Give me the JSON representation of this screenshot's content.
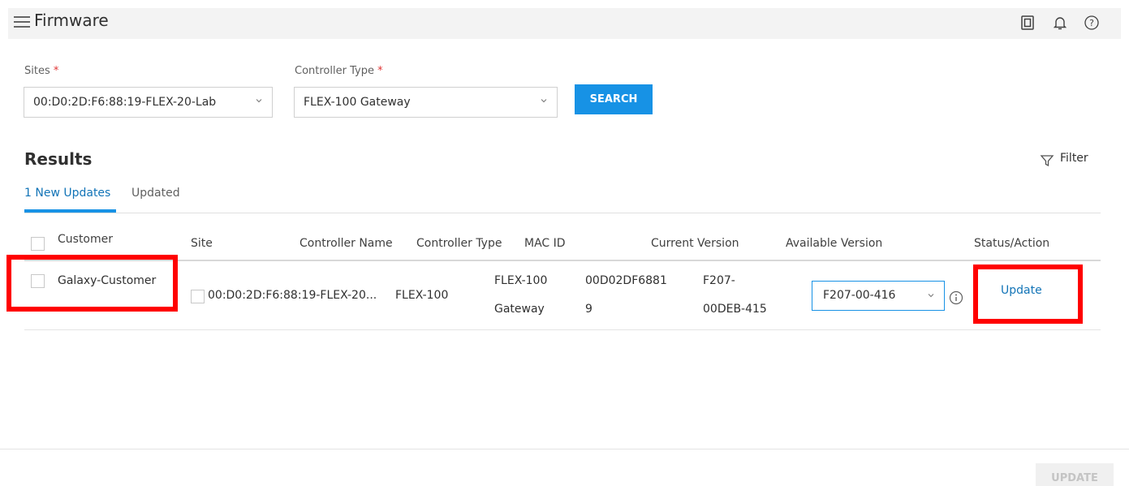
{
  "header": {
    "title": "Firmware",
    "icons": [
      "menu-icon",
      "tablet-icon",
      "bell-icon",
      "help-icon"
    ]
  },
  "form": {
    "sites": {
      "label": "Sites",
      "required_mark": "*",
      "value": "00:D0:2D:F6:88:19-FLEX-20-Lab"
    },
    "controller_type": {
      "label": "Controller Type",
      "required_mark": "*",
      "value": "FLEX-100 Gateway"
    },
    "search_label": "SEARCH"
  },
  "results": {
    "title": "Results",
    "filter_label": "Filter",
    "tabs": [
      {
        "label": "1 New Updates",
        "active": true
      },
      {
        "label": "Updated",
        "active": false
      }
    ]
  },
  "table": {
    "columns": [
      "Customer",
      "Site",
      "Controller Name",
      "Controller Type",
      "MAC ID",
      "Current Version",
      "Available Version",
      "Status/Action"
    ],
    "rows": [
      {
        "customer": "Galaxy-Customer",
        "site": "00:D0:2D:F6:88:19-FLEX-20...",
        "controller_name": "FLEX-100",
        "controller_type_line1": "FLEX-100",
        "controller_type_line2": "Gateway",
        "mac_line1": "00D02DF6881",
        "mac_line2": "9",
        "current_line1": "F207-",
        "current_line2": "00DEB-415",
        "available_version": "F207-00-416",
        "action": "Update"
      }
    ]
  },
  "footer": {
    "update_label": "UPDATE"
  },
  "colors": {
    "accent": "#1792e5",
    "link": "#1274b7",
    "highlight": "#ff0000",
    "required": "#e03434"
  }
}
